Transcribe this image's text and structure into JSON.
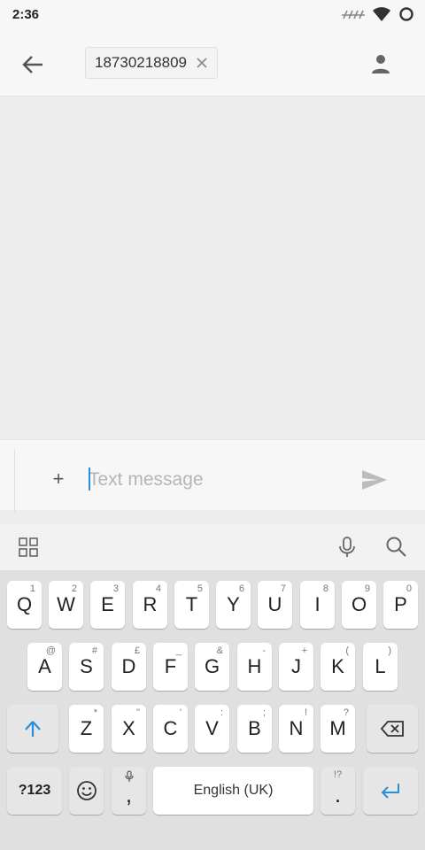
{
  "status_bar": {
    "time": "2:36"
  },
  "header": {
    "recipient": "18730218809"
  },
  "composer": {
    "placeholder": "Text message",
    "attach_label": "+"
  },
  "keyboard": {
    "rows": [
      [
        {
          "main": "Q",
          "sub": "1"
        },
        {
          "main": "W",
          "sub": "2"
        },
        {
          "main": "E",
          "sub": "3"
        },
        {
          "main": "R",
          "sub": "4"
        },
        {
          "main": "T",
          "sub": "5"
        },
        {
          "main": "Y",
          "sub": "6"
        },
        {
          "main": "U",
          "sub": "7"
        },
        {
          "main": "I",
          "sub": "8"
        },
        {
          "main": "O",
          "sub": "9"
        },
        {
          "main": "P",
          "sub": "0"
        }
      ],
      [
        {
          "main": "A",
          "sub": "@"
        },
        {
          "main": "S",
          "sub": "#"
        },
        {
          "main": "D",
          "sub": "£"
        },
        {
          "main": "F",
          "sub": "_"
        },
        {
          "main": "G",
          "sub": "&"
        },
        {
          "main": "H",
          "sub": "-"
        },
        {
          "main": "J",
          "sub": "+"
        },
        {
          "main": "K",
          "sub": "("
        },
        {
          "main": "L",
          "sub": ")"
        }
      ],
      [
        {
          "main": "Z",
          "sub": "*"
        },
        {
          "main": "X",
          "sub": "\""
        },
        {
          "main": "C",
          "sub": "'"
        },
        {
          "main": "V",
          "sub": ":"
        },
        {
          "main": "B",
          "sub": ";"
        },
        {
          "main": "N",
          "sub": "!"
        },
        {
          "main": "M",
          "sub": "?"
        }
      ]
    ],
    "symbols_label": "?123",
    "comma_label": ",",
    "space_label": "English (UK)",
    "period_label": ".",
    "period_sub": "!?"
  },
  "colors": {
    "accent": "#2a8fd8"
  }
}
